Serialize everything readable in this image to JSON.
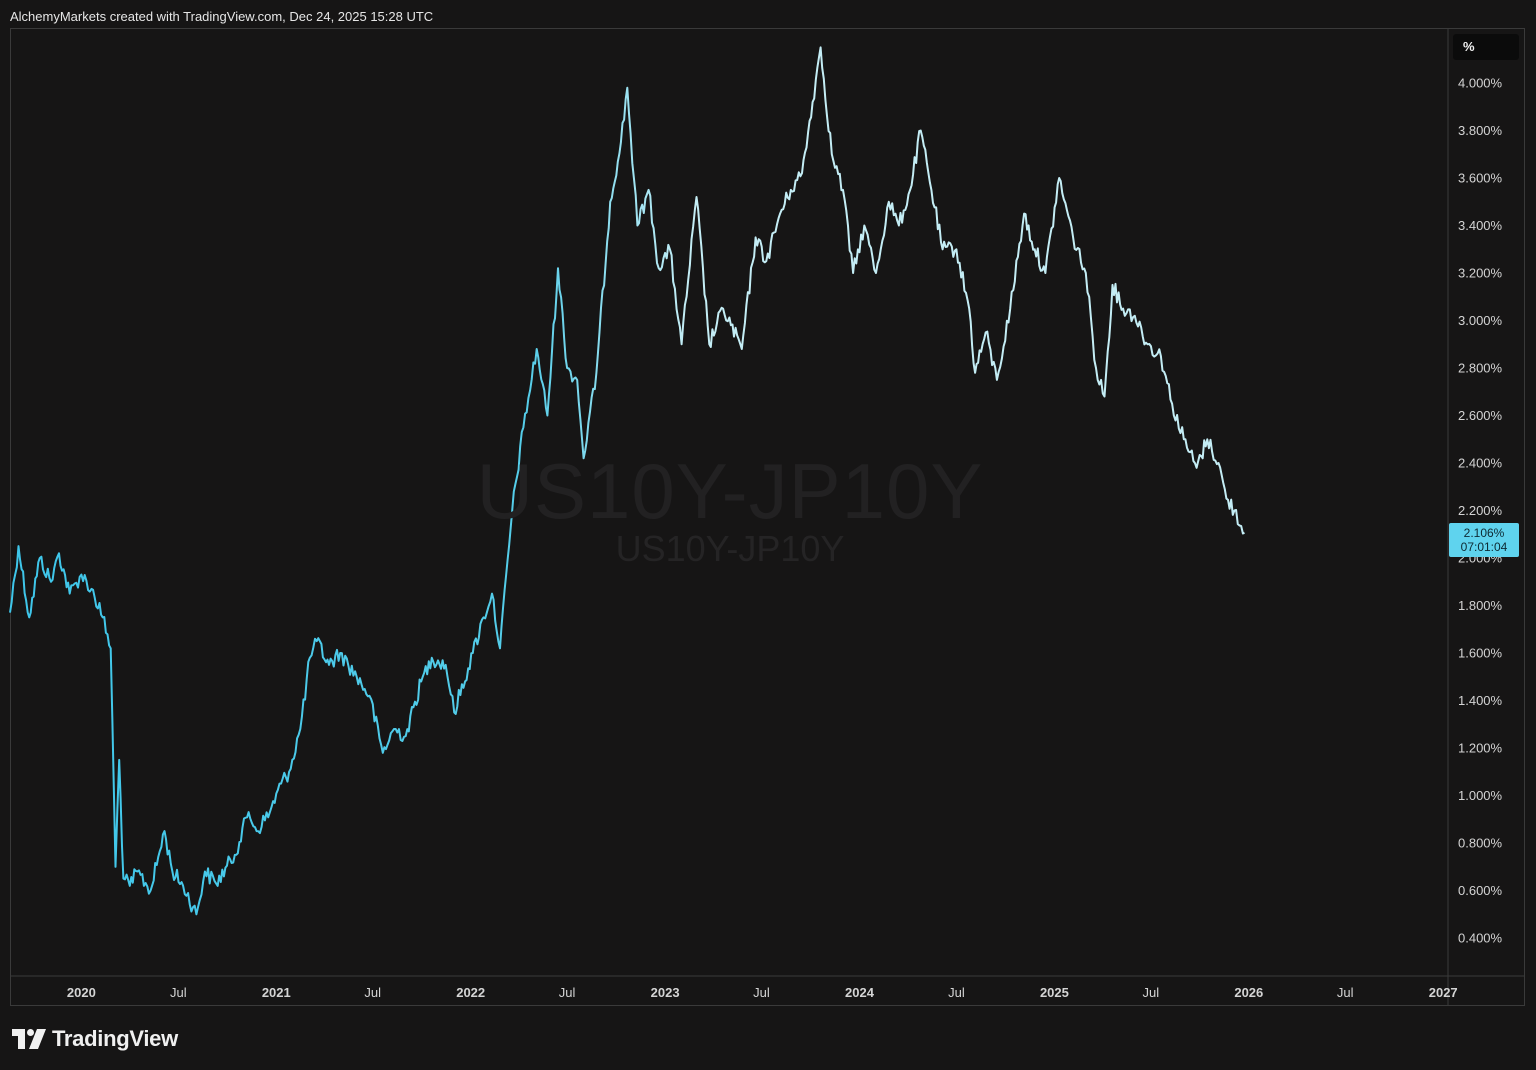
{
  "header": {
    "attribution": "AlchemyMarkets created with TradingView.com, Dec 24, 2025 15:28 UTC"
  },
  "watermark": {
    "symbol": "US10Y-JP10Y",
    "description": "US10Y-JP10Y"
  },
  "price_scale": {
    "unit": "%",
    "last_value": "2.106%",
    "countdown": "07:01:04"
  },
  "footer": {
    "brand": "TradingView",
    "logo_icon": "tradingview-logo-icon"
  },
  "colors": {
    "line_start": "#3ec6ea",
    "line_end": "#c4edf5",
    "last_price_bg": "#5fd3ee",
    "background": "#161515"
  },
  "chart_data": {
    "type": "line",
    "symbol": "US10Y-JP10Y",
    "x_axis_type": "date",
    "y_unit": "%",
    "ylim": [
      0.25,
      4.25
    ],
    "xlim": [
      "2019-08-20",
      "2027-01-10"
    ],
    "y_ticks": [
      "4.000%",
      "3.800%",
      "3.600%",
      "3.400%",
      "3.200%",
      "3.000%",
      "2.800%",
      "2.600%",
      "2.400%",
      "2.200%",
      "2.000%",
      "1.800%",
      "1.600%",
      "1.400%",
      "1.200%",
      "1.000%",
      "0.800%",
      "0.600%",
      "0.400%"
    ],
    "x_ticks": [
      {
        "date": "2020-01-01",
        "label": "2020",
        "bold": true
      },
      {
        "date": "2020-07-01",
        "label": "Jul",
        "bold": false
      },
      {
        "date": "2021-01-01",
        "label": "2021",
        "bold": true
      },
      {
        "date": "2021-07-01",
        "label": "Jul",
        "bold": false
      },
      {
        "date": "2022-01-01",
        "label": "2022",
        "bold": true
      },
      {
        "date": "2022-07-01",
        "label": "Jul",
        "bold": false
      },
      {
        "date": "2023-01-01",
        "label": "2023",
        "bold": true
      },
      {
        "date": "2023-07-01",
        "label": "Jul",
        "bold": false
      },
      {
        "date": "2024-01-01",
        "label": "2024",
        "bold": true
      },
      {
        "date": "2024-07-01",
        "label": "Jul",
        "bold": false
      },
      {
        "date": "2025-01-01",
        "label": "2025",
        "bold": true
      },
      {
        "date": "2025-07-01",
        "label": "Jul",
        "bold": false
      },
      {
        "date": "2026-01-01",
        "label": "2026",
        "bold": true
      },
      {
        "date": "2026-07-01",
        "label": "Jul",
        "bold": false
      },
      {
        "date": "2027-01-01",
        "label": "2027",
        "bold": true
      }
    ],
    "grid": false,
    "last_value": 2.106,
    "series": [
      {
        "points": [
          [
            "2019-08-20",
            1.77
          ],
          [
            "2019-09-05",
            2.05
          ],
          [
            "2019-09-25",
            1.75
          ],
          [
            "2019-10-15",
            2.0
          ],
          [
            "2019-11-05",
            1.9
          ],
          [
            "2019-11-20",
            2.02
          ],
          [
            "2019-12-10",
            1.85
          ],
          [
            "2020-01-01",
            1.93
          ],
          [
            "2020-01-20",
            1.87
          ],
          [
            "2020-02-10",
            1.75
          ],
          [
            "2020-02-25",
            1.62
          ],
          [
            "2020-03-05",
            0.7
          ],
          [
            "2020-03-12",
            1.15
          ],
          [
            "2020-03-20",
            0.65
          ],
          [
            "2020-04-01",
            0.62
          ],
          [
            "2020-04-15",
            0.68
          ],
          [
            "2020-05-10",
            0.6
          ],
          [
            "2020-06-05",
            0.85
          ],
          [
            "2020-06-20",
            0.68
          ],
          [
            "2020-07-10",
            0.62
          ],
          [
            "2020-08-04",
            0.5
          ],
          [
            "2020-08-20",
            0.68
          ],
          [
            "2020-09-10",
            0.63
          ],
          [
            "2020-10-15",
            0.75
          ],
          [
            "2020-11-10",
            0.93
          ],
          [
            "2020-11-25",
            0.85
          ],
          [
            "2020-12-20",
            0.93
          ],
          [
            "2021-01-10",
            1.05
          ],
          [
            "2021-01-25",
            1.1
          ],
          [
            "2021-02-15",
            1.28
          ],
          [
            "2021-03-05",
            1.58
          ],
          [
            "2021-03-18",
            1.65
          ],
          [
            "2021-04-10",
            1.55
          ],
          [
            "2021-05-01",
            1.6
          ],
          [
            "2021-06-01",
            1.5
          ],
          [
            "2021-06-25",
            1.42
          ],
          [
            "2021-07-20",
            1.18
          ],
          [
            "2021-08-10",
            1.28
          ],
          [
            "2021-09-01",
            1.25
          ],
          [
            "2021-09-30",
            1.48
          ],
          [
            "2021-10-20",
            1.58
          ],
          [
            "2021-11-15",
            1.55
          ],
          [
            "2021-12-01",
            1.35
          ],
          [
            "2022-01-05",
            1.6
          ],
          [
            "2022-01-25",
            1.75
          ],
          [
            "2022-02-10",
            1.85
          ],
          [
            "2022-02-25",
            1.62
          ],
          [
            "2022-03-20",
            2.2
          ],
          [
            "2022-04-10",
            2.55
          ],
          [
            "2022-05-05",
            2.88
          ],
          [
            "2022-05-25",
            2.6
          ],
          [
            "2022-06-14",
            3.22
          ],
          [
            "2022-07-01",
            2.8
          ],
          [
            "2022-07-20",
            2.75
          ],
          [
            "2022-08-01",
            2.42
          ],
          [
            "2022-08-25",
            2.78
          ],
          [
            "2022-09-20",
            3.5
          ],
          [
            "2022-10-10",
            3.75
          ],
          [
            "2022-10-22",
            3.98
          ],
          [
            "2022-11-10",
            3.4
          ],
          [
            "2022-12-01",
            3.55
          ],
          [
            "2022-12-20",
            3.22
          ],
          [
            "2023-01-10",
            3.3
          ],
          [
            "2023-02-01",
            2.9
          ],
          [
            "2023-03-01",
            3.52
          ],
          [
            "2023-03-25",
            2.9
          ],
          [
            "2023-04-20",
            3.05
          ],
          [
            "2023-05-25",
            2.88
          ],
          [
            "2023-06-20",
            3.35
          ],
          [
            "2023-07-10",
            3.25
          ],
          [
            "2023-08-05",
            3.45
          ],
          [
            "2023-08-25",
            3.55
          ],
          [
            "2023-09-15",
            3.62
          ],
          [
            "2023-10-05",
            3.92
          ],
          [
            "2023-10-20",
            4.15
          ],
          [
            "2023-11-10",
            3.7
          ],
          [
            "2023-12-01",
            3.55
          ],
          [
            "2023-12-20",
            3.2
          ],
          [
            "2024-01-10",
            3.4
          ],
          [
            "2024-02-01",
            3.2
          ],
          [
            "2024-02-25",
            3.5
          ],
          [
            "2024-03-15",
            3.4
          ],
          [
            "2024-04-05",
            3.55
          ],
          [
            "2024-04-25",
            3.8
          ],
          [
            "2024-05-15",
            3.55
          ],
          [
            "2024-06-05",
            3.3
          ],
          [
            "2024-07-01",
            3.3
          ],
          [
            "2024-07-25",
            3.05
          ],
          [
            "2024-08-05",
            2.78
          ],
          [
            "2024-08-25",
            2.95
          ],
          [
            "2024-09-15",
            2.75
          ],
          [
            "2024-10-10",
            3.05
          ],
          [
            "2024-11-05",
            3.45
          ],
          [
            "2024-11-25",
            3.3
          ],
          [
            "2024-12-15",
            3.2
          ],
          [
            "2025-01-10",
            3.6
          ],
          [
            "2025-02-05",
            3.35
          ],
          [
            "2025-03-01",
            3.2
          ],
          [
            "2025-03-20",
            2.8
          ],
          [
            "2025-04-05",
            2.68
          ],
          [
            "2025-04-20",
            3.15
          ],
          [
            "2025-05-10",
            3.05
          ],
          [
            "2025-06-01",
            3.02
          ],
          [
            "2025-06-25",
            2.9
          ],
          [
            "2025-07-20",
            2.85
          ],
          [
            "2025-08-10",
            2.65
          ],
          [
            "2025-09-01",
            2.5
          ],
          [
            "2025-09-25",
            2.38
          ],
          [
            "2025-10-15",
            2.5
          ],
          [
            "2025-11-05",
            2.4
          ],
          [
            "2025-11-20",
            2.25
          ],
          [
            "2025-12-05",
            2.2
          ],
          [
            "2025-12-24",
            2.106
          ]
        ]
      }
    ]
  }
}
